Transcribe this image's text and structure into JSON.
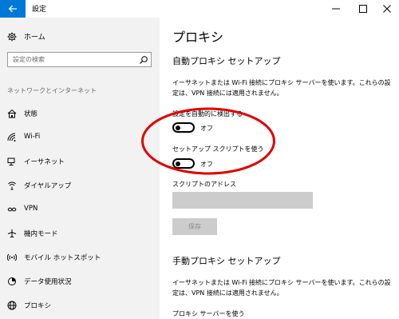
{
  "window": {
    "title": "設定"
  },
  "sidebar": {
    "home_label": "ホーム",
    "search_placeholder": "設定の検索",
    "section_label": "ネットワークとインターネット",
    "items": [
      {
        "label": "状態",
        "icon": "home-network-icon"
      },
      {
        "label": "Wi-Fi",
        "icon": "wifi-icon"
      },
      {
        "label": "イーサネット",
        "icon": "ethernet-icon"
      },
      {
        "label": "ダイヤルアップ",
        "icon": "dialup-icon"
      },
      {
        "label": "VPN",
        "icon": "vpn-icon"
      },
      {
        "label": "機内モード",
        "icon": "airplane-icon"
      },
      {
        "label": "モバイル ホットスポット",
        "icon": "hotspot-icon"
      },
      {
        "label": "データ使用状況",
        "icon": "data-usage-icon"
      },
      {
        "label": "プロキシ",
        "icon": "globe-icon",
        "active": true
      }
    ]
  },
  "main": {
    "title": "プロキシ",
    "auto_section": {
      "heading": "自動プロキシ セットアップ",
      "description": "イーサネットまたは Wi-Fi 接続にプロキシ サーバーを使います。これらの設定は、VPN 接続には適用されません。",
      "detect_label": "設定を自動的に検出する",
      "detect_state": "オフ",
      "script_label": "セットアップ スクリプトを使う",
      "script_state": "オフ",
      "address_label": "スクリプトのアドレス",
      "address_value": "",
      "save_label": "保存"
    },
    "manual_section": {
      "heading": "手動プロキシ セットアップ",
      "description": "イーサネットまたは Wi-Fi 接続にプロキシ サーバーを使います。これらの設定は、VPN 接続には適用されません。",
      "use_proxy_label": "プロキシ サーバーを使う"
    }
  },
  "colors": {
    "accent": "#0078d7",
    "sidebar_bg": "#f2f2f2",
    "annotation": "#e00000"
  }
}
